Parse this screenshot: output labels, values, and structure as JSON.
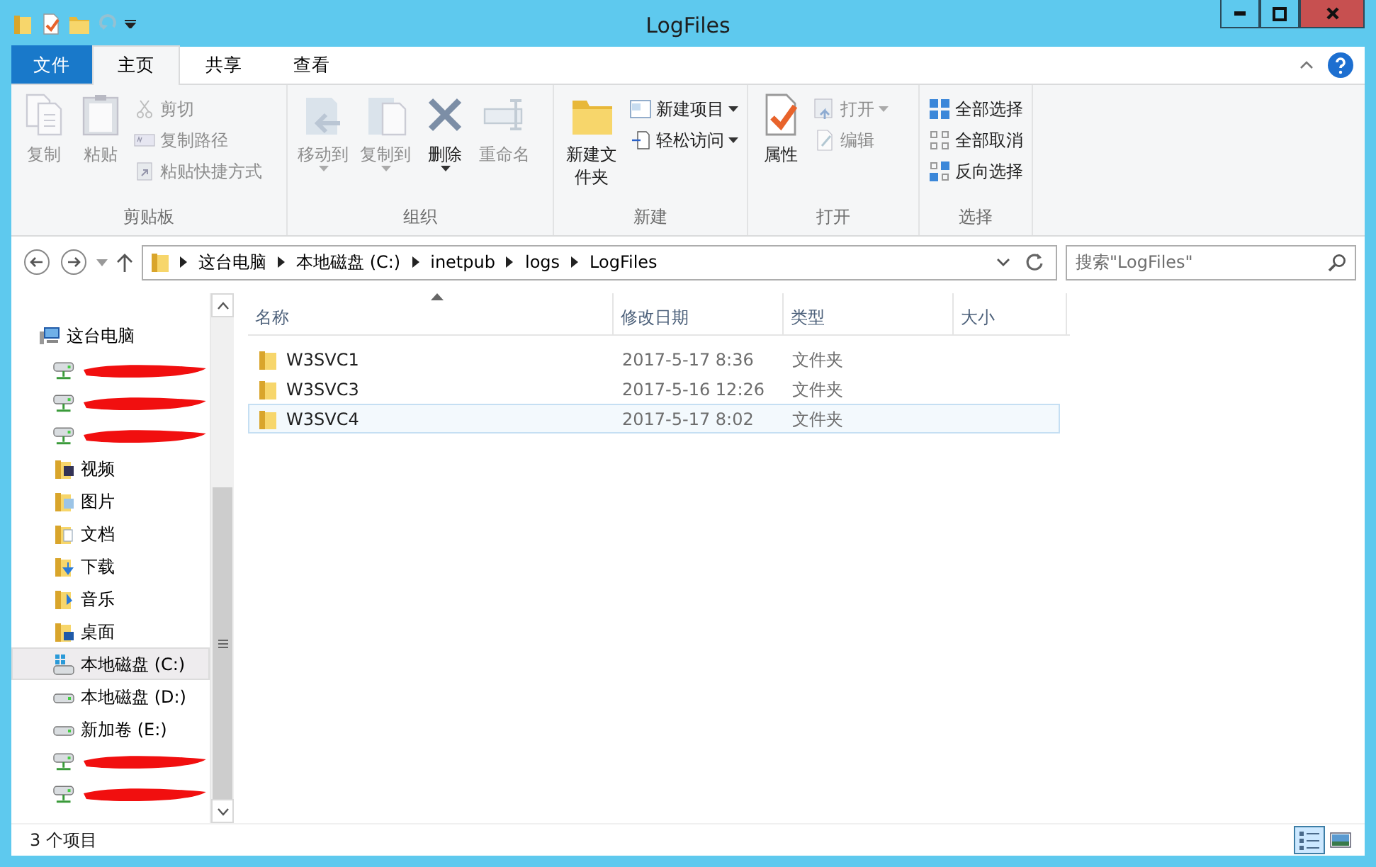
{
  "window": {
    "title": "LogFiles"
  },
  "quick_access": [
    {
      "kind": "folder"
    },
    {
      "kind": "properties"
    },
    {
      "kind": "newfolder"
    },
    {
      "kind": "undo",
      "disabled": true
    },
    {
      "kind": "customize"
    }
  ],
  "ribbon_tabs": [
    {
      "label": "文件",
      "kind": "file",
      "selected": false
    },
    {
      "label": "主页",
      "kind": "tab",
      "selected": true
    },
    {
      "label": "共享",
      "kind": "tab",
      "selected": false
    },
    {
      "label": "查看",
      "kind": "tab",
      "selected": false
    }
  ],
  "ribbon_groups": [
    {
      "label": "剪贴板",
      "large": [
        {
          "label": "复制",
          "kind": "copy",
          "disabled": true
        },
        {
          "label": "粘贴",
          "kind": "paste",
          "disabled": true
        }
      ],
      "small": [
        {
          "label": "剪切",
          "kind": "cut",
          "disabled": true
        },
        {
          "label": "复制路径",
          "kind": "copypath",
          "disabled": true
        },
        {
          "label": "粘贴快捷方式",
          "kind": "shortcut",
          "disabled": true
        }
      ]
    },
    {
      "label": "组织",
      "large": [
        {
          "label": "移动到",
          "kind": "moveto",
          "disabled": true,
          "dropdown": true
        },
        {
          "label": "复制到",
          "kind": "copyto",
          "disabled": true,
          "dropdown": true
        },
        {
          "label": "删除",
          "kind": "delete",
          "disabled": false,
          "dropdown": true
        },
        {
          "label": "重命名",
          "kind": "rename",
          "disabled": true,
          "dropdown": false
        }
      ]
    },
    {
      "label": "新建",
      "large": [
        {
          "label": "新建文件夹",
          "kind": "newfolder",
          "disabled": false
        }
      ],
      "small": [
        {
          "label": "新建项目",
          "kind": "newitem",
          "disabled": false,
          "dropdown": true
        },
        {
          "label": "轻松访问",
          "kind": "easyaccess",
          "disabled": false,
          "dropdown": true
        }
      ]
    },
    {
      "label": "打开",
      "large": [
        {
          "label": "属性",
          "kind": "properties",
          "disabled": false
        }
      ],
      "small": [
        {
          "label": "打开",
          "kind": "open",
          "disabled": true,
          "dropdown": true
        },
        {
          "label": "编辑",
          "kind": "edit",
          "disabled": true
        }
      ]
    },
    {
      "label": "选择",
      "small": [
        {
          "label": "全部选择",
          "kind": "selectall",
          "disabled": false
        },
        {
          "label": "全部取消",
          "kind": "selectnone",
          "disabled": false
        },
        {
          "label": "反向选择",
          "kind": "invert",
          "disabled": false
        }
      ]
    }
  ],
  "address": {
    "path": [
      "这台电脑",
      "本地磁盘 (C:)",
      "inetpub",
      "logs",
      "LogFiles"
    ]
  },
  "search": {
    "placeholder": "搜索\"LogFiles\""
  },
  "nav_tree": [
    {
      "label": "这台电脑",
      "kind": "computer",
      "selected": false,
      "children": [
        {
          "kind": "network",
          "redacted": true,
          "selected": false
        },
        {
          "kind": "network",
          "redacted": true,
          "selected": false
        },
        {
          "kind": "network",
          "redacted": true,
          "selected": false
        },
        {
          "label": "视频",
          "kind": "video",
          "selected": false
        },
        {
          "label": "图片",
          "kind": "pictures",
          "selected": false
        },
        {
          "label": "文档",
          "kind": "documents",
          "selected": false
        },
        {
          "label": "下载",
          "kind": "downloads",
          "selected": false
        },
        {
          "label": "音乐",
          "kind": "music",
          "selected": false
        },
        {
          "label": "桌面",
          "kind": "desktop",
          "selected": false
        },
        {
          "label": "本地磁盘 (C:)",
          "kind": "sysdrive",
          "selected": true
        },
        {
          "label": "本地磁盘 (D:)",
          "kind": "drive",
          "selected": false
        },
        {
          "label": "新加卷 (E:)",
          "kind": "drive",
          "selected": false
        },
        {
          "kind": "network",
          "redacted": true,
          "selected": false
        },
        {
          "kind": "network",
          "redacted": true,
          "selected": false
        }
      ]
    }
  ],
  "file_list": {
    "columns": [
      {
        "label": "名称",
        "sorted": true
      },
      {
        "label": "修改日期",
        "sorted": false
      },
      {
        "label": "类型",
        "sorted": false
      },
      {
        "label": "大小",
        "sorted": false
      }
    ],
    "rows": [
      {
        "name": "W3SVC1",
        "modified": "2017-5-17 8:36",
        "type": "文件夹",
        "selected": false
      },
      {
        "name": "W3SVC3",
        "modified": "2017-5-16 12:26",
        "type": "文件夹",
        "selected": false
      },
      {
        "name": "W3SVC4",
        "modified": "2017-5-17 8:02",
        "type": "文件夹",
        "selected": true
      }
    ]
  },
  "status_bar": {
    "item_count": "3 个项目",
    "views": [
      {
        "kind": "details",
        "selected": true
      },
      {
        "kind": "largeicons",
        "selected": false
      }
    ]
  }
}
